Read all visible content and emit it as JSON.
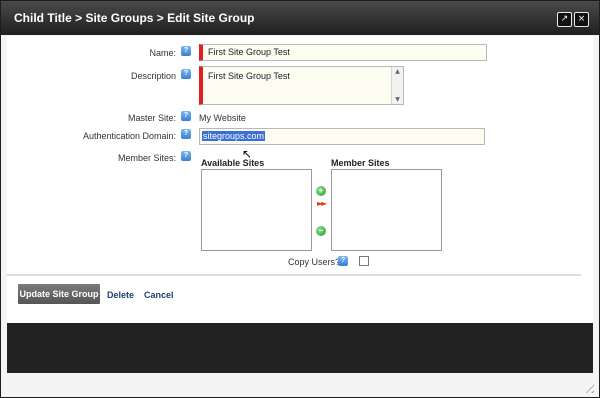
{
  "dialog": {
    "title": "Child Title > Site Groups > Edit Site Group",
    "external_icon": "↗",
    "close_icon": "×"
  },
  "form": {
    "name_label": "Name:",
    "name_value": "First Site Group Test",
    "description_label": "Description",
    "description_value": "First Site Group Test",
    "master_site_label": "Master Site:",
    "master_site_value": "My Website",
    "auth_domain_label": "Authentication Domain:",
    "auth_domain_value": "sitegroups.com",
    "member_sites_label": "Member Sites:",
    "available_sites_header": "Available Sites",
    "member_sites_header": "Member Sites",
    "copy_users_label": "Copy Users?",
    "help_glyph": "?"
  },
  "actions": {
    "update_label": "Update Site Group",
    "delete_label": "Delete",
    "cancel_label": "Cancel"
  },
  "colors": {
    "required_marker": "#e02020",
    "link": "#1f3f73",
    "selection": "#3b6fd6"
  }
}
